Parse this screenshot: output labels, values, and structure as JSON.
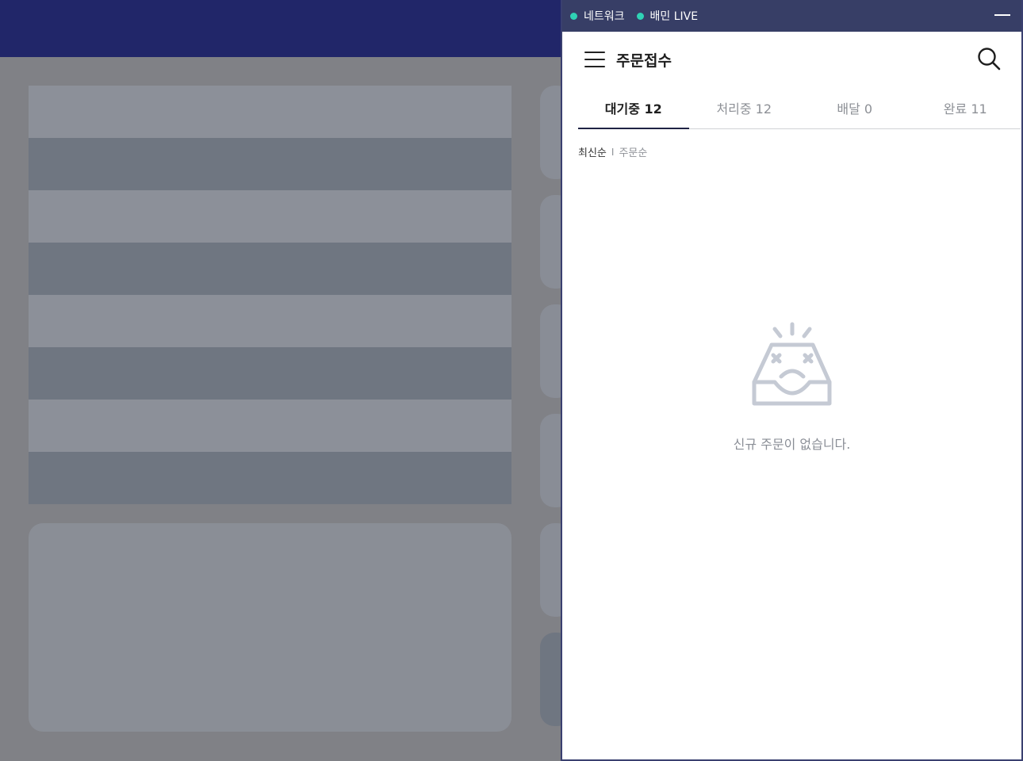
{
  "titlebar": {
    "network_label": "네트워크",
    "live_label": "배민 LIVE",
    "status_color": "#2fd2b5"
  },
  "header": {
    "menu_icon": "hamburger-menu-icon",
    "title": "주문접수",
    "search_icon": "search-icon"
  },
  "tabs": [
    {
      "label": "대기중 12",
      "active": true
    },
    {
      "label": "처리중 12",
      "active": false
    },
    {
      "label": "배달 0",
      "active": false
    },
    {
      "label": "완료 11",
      "active": false
    }
  ],
  "sort": {
    "options": [
      "최신순",
      "주문순"
    ],
    "separator": "I",
    "selected": "최신순"
  },
  "empty_state": {
    "icon": "empty-inbox-icon",
    "message": "신규 주문이 없습니다."
  },
  "colors": {
    "background_topbar": "#212669",
    "window_titlebar": "#373e66",
    "accent_dark": "#1f2344"
  }
}
